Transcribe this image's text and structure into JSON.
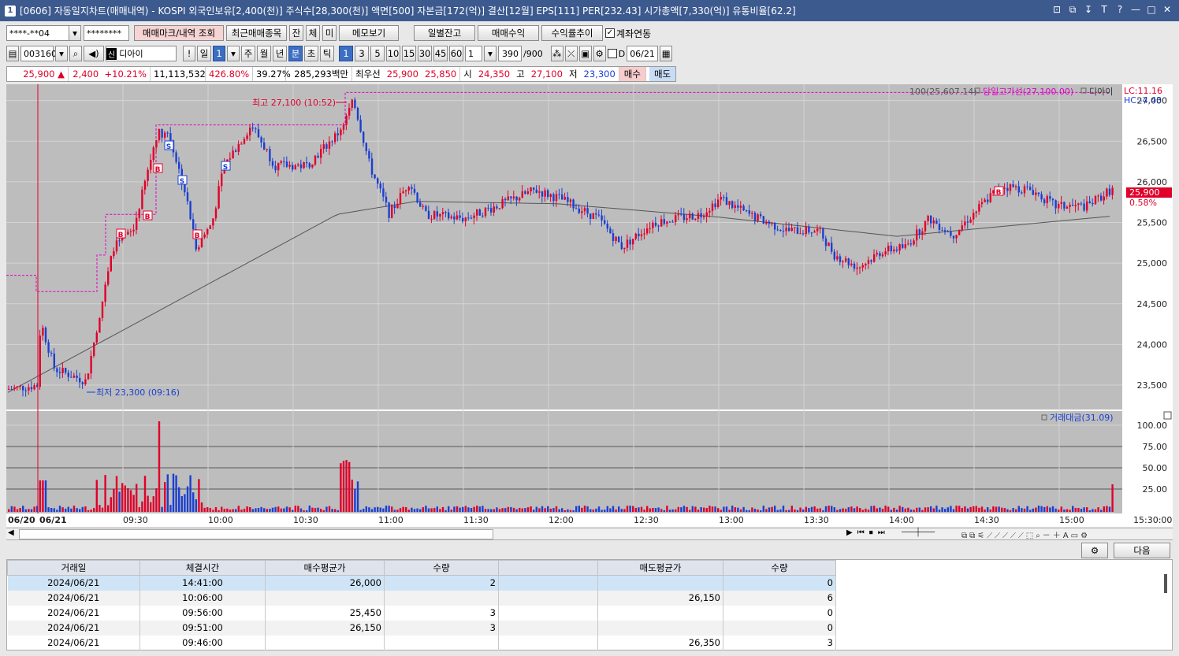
{
  "window": {
    "number": "1",
    "title": "[0606] 자동일지차트(매매내역) - KOSPI 외국인보유[2,400(천)] 주식수[28,300(천)] 액면[500] 자본금[172(억)] 결산[12월] EPS[111] PER[232.43] 시가총액[7,330(억)] 유통비율[62.2]",
    "controls": [
      "⊡",
      "⧉",
      "↧",
      "T",
      "?",
      "—",
      "□",
      "✕"
    ]
  },
  "toolbar1": {
    "account": "****-**04",
    "password": "********",
    "btn_trade_mark": "매매마크/내역 조회",
    "btn_recent": "최근매매종목",
    "tabs": [
      "잔",
      "체",
      "미"
    ],
    "btn_memo": "메모보기",
    "btn_daily": "일별잔고",
    "btn_profit": "매매수익",
    "btn_return": "수익률추이",
    "account_link_label": "계좌연동"
  },
  "toolbar2": {
    "code": "003160",
    "new_badge": "신",
    "name": "디아이",
    "exclaim": "!",
    "day_label": "일",
    "day_value": "1",
    "periods": [
      "주",
      "월",
      "년",
      "분",
      "초",
      "틱"
    ],
    "active_period": "분",
    "intervals": [
      "1",
      "3",
      "5",
      "10",
      "15",
      "30",
      "45",
      "60"
    ],
    "active_interval": "1",
    "interval_select": "1",
    "count": "390",
    "count_max": "/900",
    "d_label": "D",
    "date": "06/21"
  },
  "quote": {
    "price": "25,900",
    "arrow": "▲",
    "change": "2,400",
    "change_pct": "+10.21%",
    "volume": "11,113,532",
    "vol_ratio": "426.80%",
    "turnover": "39.27%",
    "amount": "285,293백만",
    "best_label": "최우선",
    "best_ask": "25,900",
    "best_bid": "25,850",
    "open_label": "시",
    "open": "24,350",
    "high_label": "고",
    "high": "27,100",
    "low_label": "저",
    "low": "23,300",
    "buy": "매수",
    "sell": "매도"
  },
  "chart_labels": {
    "ma_legend": "100(25,607.14)",
    "high_line_legend": "당일고가선(27,100.00)",
    "stock_legend": "디아이",
    "lc": "LC:11.16",
    "hc": "HC:-4.43",
    "high_annot": "최고 27,100 (10:52)",
    "low_annot": "최저 23,300 (09:16)",
    "current_price": "25,900",
    "current_pct": "0.58%",
    "volume_legend": "거래대금(31.09)"
  },
  "chart_data": {
    "type": "candlestick",
    "price_ticks": [
      "27,000",
      "26,500",
      "26,000",
      "25,500",
      "25,000",
      "24,500",
      "24,000",
      "23,500"
    ],
    "ylim": [
      23200,
      27200
    ],
    "volume_ticks": [
      "100.00",
      "75.00",
      "50.00",
      "25.00"
    ],
    "x_ticks": [
      "06/20",
      "06/21",
      "09:30",
      "10:00",
      "10:30",
      "11:00",
      "11:30",
      "12:00",
      "12:30",
      "13:00",
      "13:30",
      "14:00",
      "14:30",
      "15:00",
      "15:30:00"
    ],
    "trade_marks": [
      {
        "type": "B",
        "time": "09:36"
      },
      {
        "type": "S",
        "time": "09:37"
      },
      {
        "type": "B",
        "time": "09:41"
      },
      {
        "type": "S",
        "time": "09:46"
      },
      {
        "type": "B",
        "time": "09:51"
      },
      {
        "type": "B",
        "time": "09:56"
      },
      {
        "type": "S",
        "time": "10:06"
      },
      {
        "type": "B",
        "time": "14:41"
      }
    ],
    "ma100_label": "100",
    "day_high": 27100,
    "day_low": 23300,
    "close": 25900
  },
  "toolbar3": {
    "settings": "⚙",
    "next": "다음"
  },
  "table": {
    "headers": [
      "거래일",
      "체결시간",
      "매수평균가",
      "수량",
      "",
      "매도평균가",
      "수량"
    ],
    "rows": [
      [
        "2024/06/21",
        "14:41:00",
        "26,000",
        "2",
        "",
        "",
        "0"
      ],
      [
        "2024/06/21",
        "10:06:00",
        "",
        "",
        "",
        "26,150",
        "6"
      ],
      [
        "2024/06/21",
        "09:56:00",
        "25,450",
        "3",
        "",
        "",
        "0"
      ],
      [
        "2024/06/21",
        "09:51:00",
        "26,150",
        "3",
        "",
        "",
        "0"
      ],
      [
        "2024/06/21",
        "09:46:00",
        "",
        "",
        "",
        "26,350",
        "3"
      ]
    ]
  }
}
